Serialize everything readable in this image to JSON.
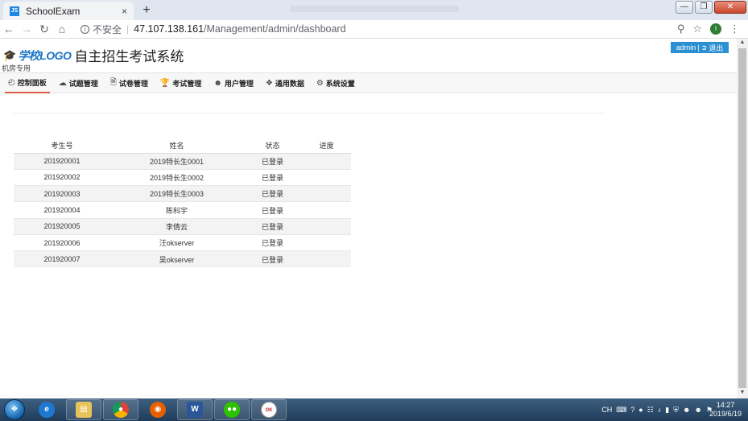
{
  "browser": {
    "tab_title": "SchoolExam",
    "tab_favicon": "JS",
    "tab_close": "×",
    "new_tab": "+",
    "insecure_label": "不安全",
    "url_host": "47.107.138.161",
    "url_path": "/Management/admin/dashboard",
    "extension_badge": "I"
  },
  "header": {
    "logo_text": "学校LOGO",
    "app_title": "自主招生考试系统",
    "subtitle": "机房专用",
    "user": "admin",
    "logout": "退出"
  },
  "nav": {
    "items": [
      {
        "label": "控制面板",
        "icon": "dashboard-icon",
        "active": true
      },
      {
        "label": "试题管理",
        "icon": "cloud-icon"
      },
      {
        "label": "试卷管理",
        "icon": "file-icon"
      },
      {
        "label": "考试管理",
        "icon": "trophy-icon"
      },
      {
        "label": "用户管理",
        "icon": "user-icon"
      },
      {
        "label": "通用数据",
        "icon": "cubes-icon"
      },
      {
        "label": "系统设置",
        "icon": "gear-icon"
      }
    ]
  },
  "table": {
    "headers": [
      "考生号",
      "姓名",
      "状态",
      "进度"
    ],
    "rows": [
      {
        "id": "201920001",
        "name": "2019特长生0001",
        "status": "已登录",
        "progress": ""
      },
      {
        "id": "201920002",
        "name": "2019特长生0002",
        "status": "已登录",
        "progress": ""
      },
      {
        "id": "201920003",
        "name": "2019特长生0003",
        "status": "已登录",
        "progress": ""
      },
      {
        "id": "201920004",
        "name": "陈科宇",
        "status": "已登录",
        "progress": ""
      },
      {
        "id": "201920005",
        "name": "李倩云",
        "status": "已登录",
        "progress": ""
      },
      {
        "id": "201920006",
        "name": "汪okserver",
        "status": "已登录",
        "progress": ""
      },
      {
        "id": "201920007",
        "name": "吴okserver",
        "status": "已登录",
        "progress": ""
      }
    ]
  },
  "taskbar": {
    "clock_time": "14:27",
    "clock_date": "2019/6/19",
    "ime": "CH"
  },
  "colors": {
    "accent": "#2b8fd1",
    "active_underline": "#e05a4a"
  }
}
